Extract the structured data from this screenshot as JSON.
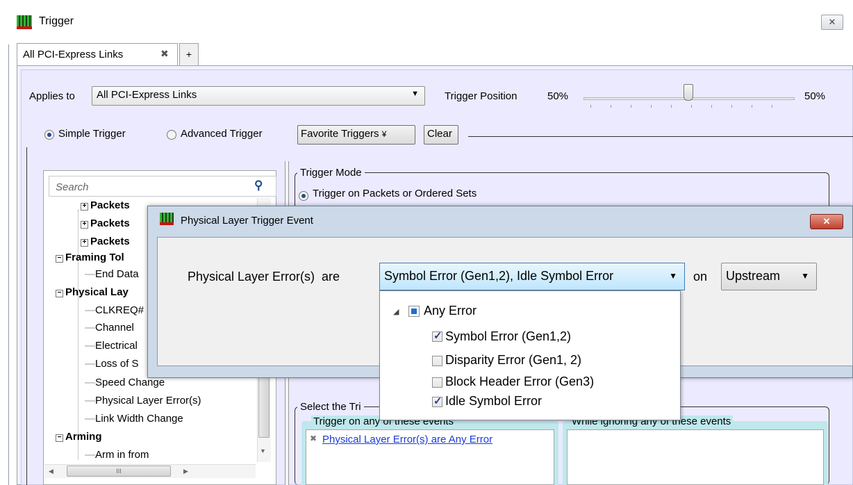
{
  "window": {
    "title": "Trigger",
    "close_glyph": "✕"
  },
  "tabs": [
    {
      "label": "All PCI-Express Links",
      "close_glyph": "✖"
    }
  ],
  "tab_add_glyph": "+",
  "applies_to": {
    "label": "Applies to",
    "value": "All PCI-Express Links"
  },
  "trigger_position": {
    "label": "Trigger Position",
    "left_value": "50%",
    "right_value": "50%",
    "level_fraction": 0.5
  },
  "modes": {
    "simple": "Simple Trigger",
    "advanced": "Advanced Trigger",
    "selected": "simple"
  },
  "buttons": {
    "favorites": "Favorite Triggers",
    "favorites_glyph": "¥",
    "clear": "Clear"
  },
  "search": {
    "placeholder": "Search"
  },
  "tree": {
    "items": [
      {
        "text": "Packets",
        "bold": true,
        "expander": "+"
      },
      {
        "text": "Packets",
        "bold": true,
        "expander": "+"
      },
      {
        "text": "Packets",
        "bold": true,
        "expander": "+"
      },
      {
        "text": "Framing Tol",
        "bold": true,
        "expander": "−"
      },
      {
        "text": "End Data",
        "bold": false
      },
      {
        "text": "Physical Lay",
        "bold": true,
        "expander": "−"
      },
      {
        "text": "CLKREQ#",
        "bold": false
      },
      {
        "text": "Channel",
        "bold": false
      },
      {
        "text": "Electrical",
        "bold": false
      },
      {
        "text": "Loss of S",
        "bold": false
      },
      {
        "text": "Speed Change",
        "bold": false
      },
      {
        "text": "Physical Layer Error(s)",
        "bold": false
      },
      {
        "text": "Link Width Change",
        "bold": false
      },
      {
        "text": "Arming",
        "bold": true,
        "expander": "−"
      },
      {
        "text": "Arm in from",
        "bold": false
      }
    ],
    "hscroll_glyph": "III"
  },
  "trigger_mode": {
    "legend": "Trigger Mode",
    "option": "Trigger on Packets or Ordered Sets"
  },
  "select_group": {
    "legend": "Select the Tri",
    "trigger_on": {
      "legend": "Trigger on any of these events",
      "items": [
        "Physical Layer Error(s) are Any Error"
      ],
      "item_glyph": "✖"
    },
    "ignoring": {
      "legend": "While ignoring any of these events",
      "items": []
    }
  },
  "dialog": {
    "title": "Physical Layer Trigger Event",
    "close_glyph": "✕",
    "prefix": "Physical Layer Error(s)  are",
    "error_value": "Symbol Error (Gen1,2), Idle Symbol Error",
    "on_label": "on",
    "direction": "Upstream",
    "popup": {
      "root": {
        "label": "Any Error",
        "state": "partial"
      },
      "items": [
        {
          "label": "Symbol Error (Gen1,2)",
          "checked": true
        },
        {
          "label": "Disparity Error (Gen1, 2)",
          "checked": false
        },
        {
          "label": "Block Header Error (Gen3)",
          "checked": false
        },
        {
          "label": "Idle Symbol Error",
          "checked": true
        }
      ]
    }
  }
}
